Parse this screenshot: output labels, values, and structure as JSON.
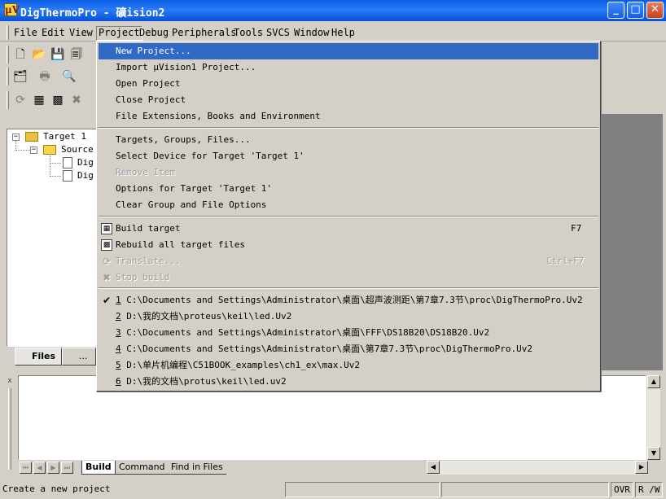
{
  "window": {
    "app_icon": "µV",
    "title": "DigThermoPro  - 礦ision2",
    "minimize": "_",
    "maximize": "□",
    "close": "✕"
  },
  "menubar": {
    "items": [
      {
        "label": "File"
      },
      {
        "label": "Edit"
      },
      {
        "label": "View"
      },
      {
        "label": "Project"
      },
      {
        "label": "Debug"
      },
      {
        "label": "Peripherals"
      },
      {
        "label": "Tools"
      },
      {
        "label": "SVCS"
      },
      {
        "label": "Window"
      },
      {
        "label": "Help"
      }
    ],
    "active": "Project"
  },
  "toolbar_icons": [
    "new-file-icon",
    "open-folder-icon",
    "save-icon",
    "save-all-icon",
    "project-window-icon",
    "print-icon",
    "find-icon",
    "translate-icon",
    "build-icon",
    "rebuild-icon",
    "stop-build-icon"
  ],
  "project_tree": {
    "root": "Target 1",
    "group": "Source",
    "files": [
      "Dig",
      "Dig"
    ],
    "expand_glyph": "−"
  },
  "project_tabs": [
    {
      "label": "Files"
    },
    {
      "label": "..."
    }
  ],
  "output": {
    "close_glyph": "x",
    "tabs": [
      {
        "label": "Build",
        "active": true
      },
      {
        "label": "Command",
        "active": false
      },
      {
        "label": "Find in Files",
        "active": false
      }
    ],
    "text": ""
  },
  "status": {
    "message": "Create a new project",
    "ovr": "OVR",
    "rw": "R /W"
  },
  "project_menu": {
    "items": [
      {
        "label": "New Project...",
        "highlight": true
      },
      {
        "label": "Import μVision1 Project..."
      },
      {
        "label": "Open Project"
      },
      {
        "label": "Close Project"
      },
      {
        "label": "File Extensions, Books and Environment"
      },
      {
        "label": "Targets, Groups, Files..."
      },
      {
        "label": "Select Device for Target 'Target 1'"
      },
      {
        "label": "Remove Item",
        "disabled": true
      },
      {
        "label": "Options for Target 'Target 1'"
      },
      {
        "label": "Clear Group and File Options"
      },
      {
        "label": "Build target",
        "shortcut": "F7",
        "icon": "build-icon"
      },
      {
        "label": "Rebuild all target files",
        "icon": "rebuild-icon"
      },
      {
        "label": "Translate...",
        "shortcut": "Ctrl+F7",
        "disabled": true,
        "icon": "translate-icon"
      },
      {
        "label": "Stop build",
        "disabled": true,
        "icon": "stop-build-icon"
      }
    ],
    "recent_projects": [
      {
        "num": "1",
        "path": " C:\\Documents and Settings\\Administrator\\桌面\\超声波测距\\第7章7.3节\\proc\\DigThermoPro.Uv2",
        "checked": true
      },
      {
        "num": "2",
        "path": " D:\\我的文档\\proteus\\keil\\led.Uv2"
      },
      {
        "num": "3",
        "path": " C:\\Documents and Settings\\Administrator\\桌面\\FFF\\DS18B20\\DS18B20.Uv2"
      },
      {
        "num": "4",
        "path": " C:\\Documents and Settings\\Administrator\\桌面\\第7章7.3节\\proc\\DigThermoPro.Uv2"
      },
      {
        "num": "5",
        "path": " D:\\单片机编程\\C51BOOK_examples\\ch1_ex\\max.Uv2"
      },
      {
        "num": "6",
        "path": " D:\\我的文档\\protus\\keil\\led.uv2"
      }
    ],
    "check_glyph": "✔"
  }
}
